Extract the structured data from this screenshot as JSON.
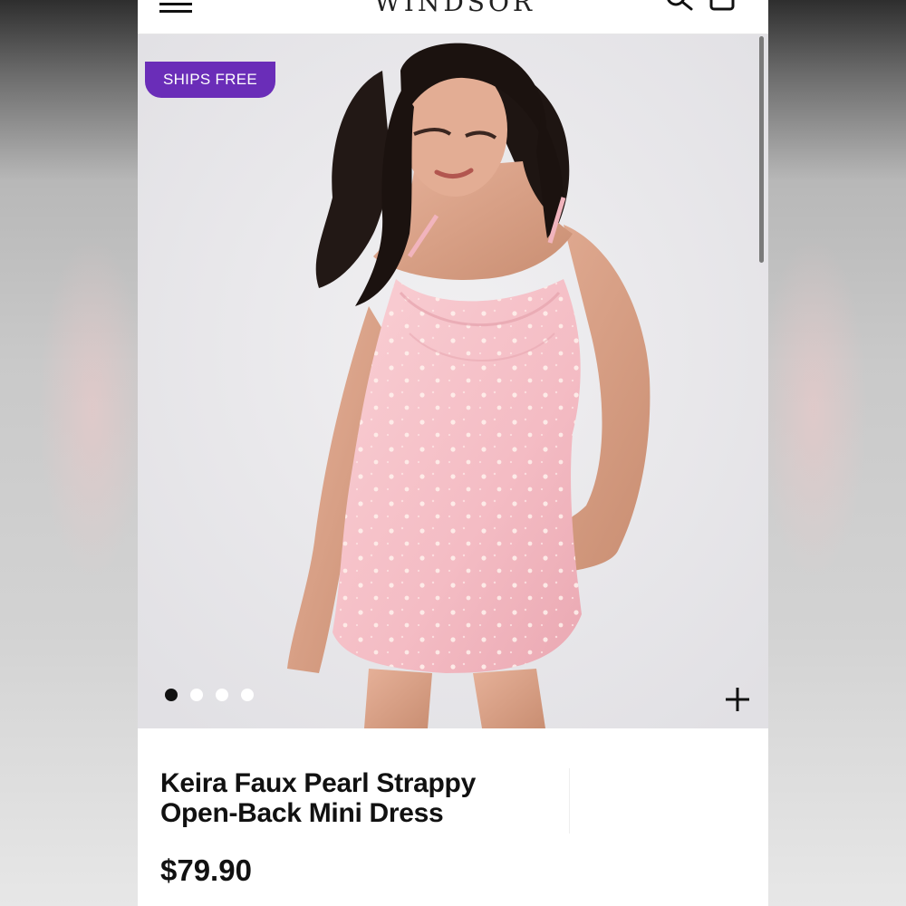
{
  "header": {
    "logo_text": "WINDSOR",
    "icons": [
      "menu-icon",
      "search-icon",
      "bag-icon"
    ]
  },
  "gallery": {
    "badge": "SHIPS FREE",
    "badge_color": "#6a2db8",
    "dots_count": 4,
    "active_dot": 1,
    "zoom_icon": "plus-icon"
  },
  "product": {
    "title": "Keira Faux Pearl Strappy Open-Back Mini Dress",
    "price": "$79.90"
  },
  "colors": {
    "dress_pink": "#f6bfc6",
    "background": "#ececee"
  }
}
